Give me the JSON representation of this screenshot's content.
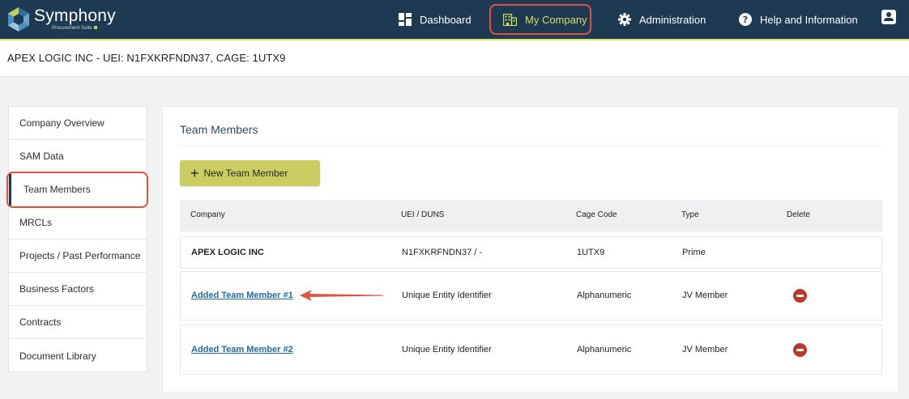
{
  "brand": {
    "name": "Symphony",
    "subtitle": "Procurement Suite"
  },
  "nav": {
    "dashboard": "Dashboard",
    "my_company": "My Company",
    "administration": "Administration",
    "help": "Help and Information"
  },
  "company_header": {
    "title": "APEX LOGIC INC - UEI: N1FXKRFNDN37, CAGE: 1UTX9"
  },
  "sidebar": {
    "items": [
      {
        "label": "Company Overview"
      },
      {
        "label": "SAM Data"
      },
      {
        "label": "Team Members",
        "active": true
      },
      {
        "label": "MRCLs"
      },
      {
        "label": "Projects / Past Performance"
      },
      {
        "label": "Business Factors"
      },
      {
        "label": "Contracts"
      },
      {
        "label": "Document Library"
      }
    ]
  },
  "main": {
    "title": "Team Members",
    "new_button": "New Team Member",
    "columns": [
      "Company",
      "UEI / DUNS",
      "Cage Code",
      "Type",
      "Delete"
    ],
    "rows": [
      {
        "company": "APEX LOGIC INC",
        "uei": "N1FXKRFNDN37 / -",
        "cage": "1UTX9",
        "type": "Prime"
      },
      {
        "company": "Added Team Member #1",
        "uei": "Unique Entity Identifier",
        "cage": "Alphanumeric",
        "type": "JV Member"
      },
      {
        "company": "Added Team Member #2",
        "uei": "Unique Entity Identifier",
        "cage": "Alphanumeric",
        "type": "JV Member"
      }
    ]
  },
  "colors": {
    "topbar": "#1d3a52",
    "accent": "#c9cd62",
    "highlight": "#e0533d",
    "delete": "#b83a2a",
    "link": "#1f6aa8"
  }
}
